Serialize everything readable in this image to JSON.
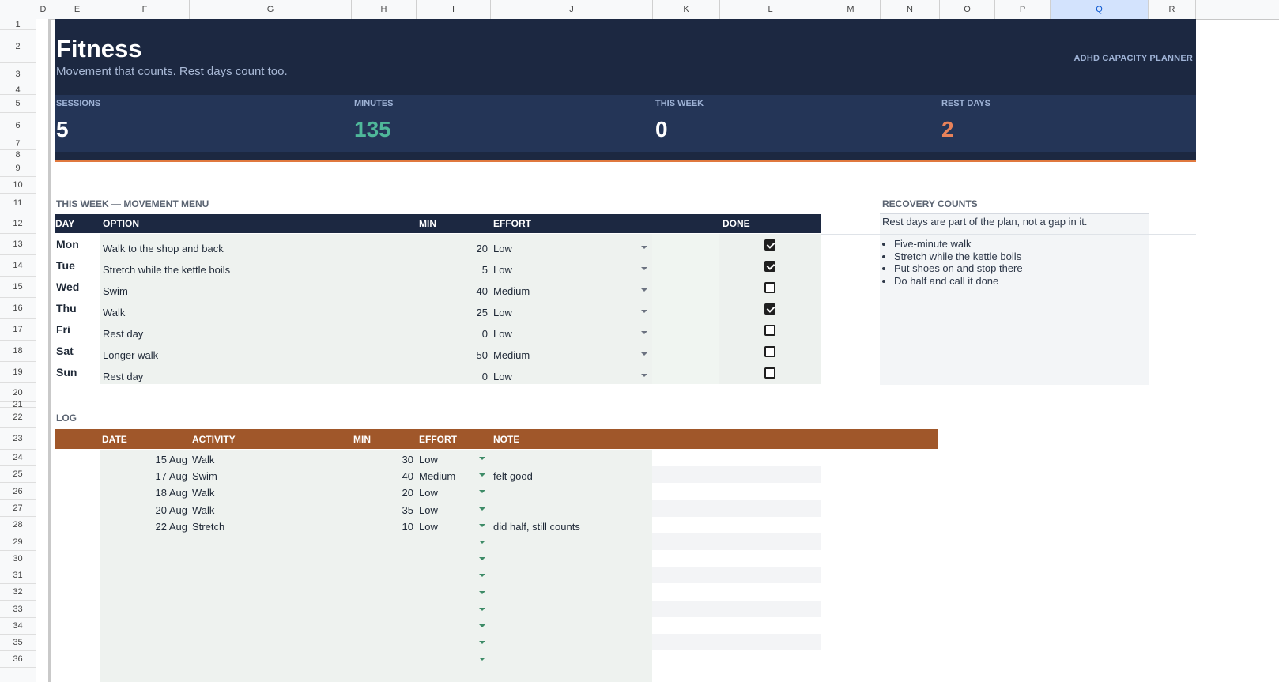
{
  "columns": [
    "D",
    "E",
    "F",
    "G",
    "H",
    "I",
    "J",
    "K",
    "L",
    "M",
    "N",
    "O",
    "P",
    "Q",
    "R"
  ],
  "selected_column": "Q",
  "rows": [
    "1",
    "2",
    "3",
    "4",
    "5",
    "6",
    "7",
    "8",
    "9",
    "10",
    "11",
    "12",
    "13",
    "14",
    "15",
    "16",
    "17",
    "18",
    "19",
    "20",
    "21",
    "22",
    "23",
    "24",
    "25",
    "26",
    "27",
    "28",
    "29",
    "30",
    "31",
    "32",
    "33",
    "34",
    "35",
    "36"
  ],
  "header": {
    "title": "Fitness",
    "subtitle": "Movement that counts. Rest days count too.",
    "brand": "ADHD CAPACITY PLANNER"
  },
  "stats": [
    {
      "label": "SESSIONS",
      "value": "5",
      "color": "#ffffff"
    },
    {
      "label": "MINUTES",
      "value": "135",
      "color": "#4fb89a"
    },
    {
      "label": "THIS WEEK",
      "value": "0",
      "color": "#ffffff"
    },
    {
      "label": "REST DAYS",
      "value": "2",
      "color": "#e8825a"
    }
  ],
  "menu": {
    "section_title": "THIS WEEK — MOVEMENT MENU",
    "headers": {
      "day": "DAY",
      "option": "OPTION",
      "min": "MIN",
      "effort": "EFFORT",
      "done": "DONE"
    },
    "rows": [
      {
        "day": "Mon",
        "option": "Walk to the shop and back",
        "min": "20",
        "effort": "Low",
        "done": true
      },
      {
        "day": "Tue",
        "option": "Stretch while the kettle boils",
        "min": "5",
        "effort": "Low",
        "done": true
      },
      {
        "day": "Wed",
        "option": "Swim",
        "min": "40",
        "effort": "Medium",
        "done": false
      },
      {
        "day": "Thu",
        "option": "Walk",
        "min": "25",
        "effort": "Low",
        "done": true
      },
      {
        "day": "Fri",
        "option": "Rest day",
        "min": "0",
        "effort": "Low",
        "done": false
      },
      {
        "day": "Sat",
        "option": "Longer walk",
        "min": "50",
        "effort": "Medium",
        "done": false
      },
      {
        "day": "Sun",
        "option": "Rest day",
        "min": "0",
        "effort": "Low",
        "done": false
      }
    ]
  },
  "recovery": {
    "title": "RECOVERY COUNTS",
    "intro": "Rest days are part of the plan, not a gap in it.",
    "items": [
      "Five-minute walk",
      "Stretch while the kettle boils",
      "Put shoes on and stop there",
      "Do half and call it done"
    ]
  },
  "log": {
    "section_title": "LOG",
    "headers": {
      "date": "DATE",
      "activity": "ACTIVITY",
      "min": "MIN",
      "effort": "EFFORT",
      "note": "NOTE"
    },
    "rows": [
      {
        "date": "15 Aug",
        "activity": "Walk",
        "min": "30",
        "effort": "Low",
        "note": ""
      },
      {
        "date": "17 Aug",
        "activity": "Swim",
        "min": "40",
        "effort": "Medium",
        "note": "felt good"
      },
      {
        "date": "18 Aug",
        "activity": "Walk",
        "min": "20",
        "effort": "Low",
        "note": ""
      },
      {
        "date": "20 Aug",
        "activity": "Walk",
        "min": "35",
        "effort": "Low",
        "note": ""
      },
      {
        "date": "22 Aug",
        "activity": "Stretch",
        "min": "10",
        "effort": "Low",
        "note": "did half, still counts"
      }
    ],
    "empty_rows": 8
  }
}
